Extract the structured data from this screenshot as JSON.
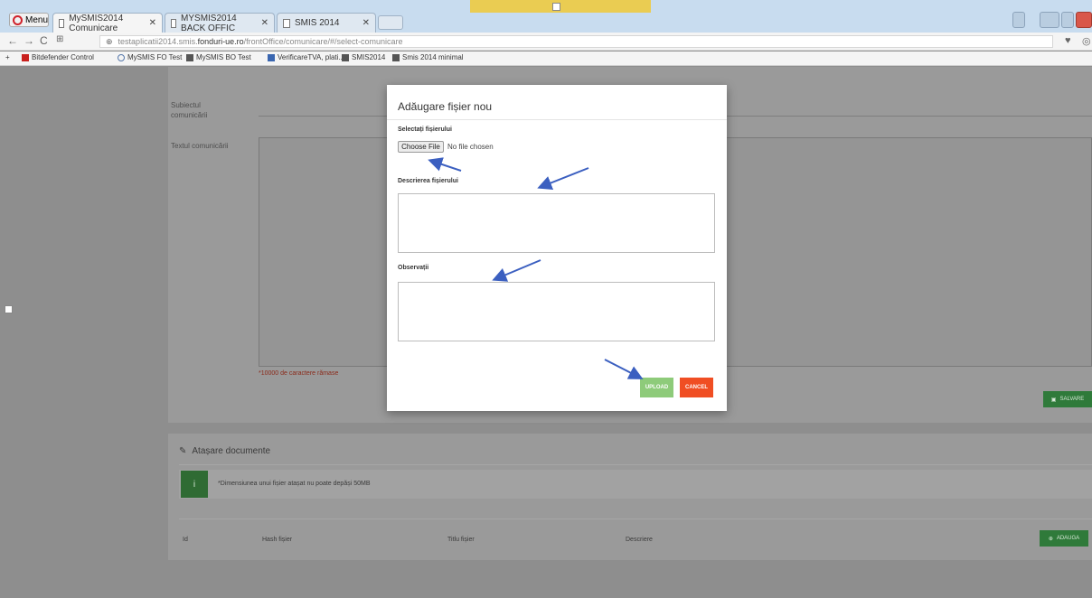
{
  "browser": {
    "opera_menu": "Menu",
    "tabs": [
      {
        "title": "MySMIS2014 Comunicare",
        "active": true
      },
      {
        "title": "MYSMIS2014 BACK OFFIC",
        "active": false
      },
      {
        "title": "SMIS 2014",
        "active": false
      }
    ],
    "url_prefix": "testaplicatii2014.smis.",
    "url_domain": "fonduri-ue.ro",
    "url_path": "/frontOffice/comunicare/#/select-comunicare",
    "bookmarks": [
      {
        "label": "Bitdefender Control"
      },
      {
        "label": "MySMIS FO Test"
      },
      {
        "label": "MySMIS BO Test"
      },
      {
        "label": "VerificareTVA, plati..."
      },
      {
        "label": "SMIS2014"
      },
      {
        "label": "Smis 2014 minimal"
      }
    ]
  },
  "background_page": {
    "subject_label_1": "Subiectul",
    "subject_label_2": "comunicării",
    "text_label": "Textul comunicării",
    "char_note": "*10000 de caractere rămase",
    "save_label": "SALVARE",
    "attachments_title": "Atașare documente",
    "info_text": "*Dimensiunea unui fișier atașat nu poate depăși 50MB",
    "table_headers": [
      "Id",
      "Hash fișier",
      "Titlu fișier",
      "Descriere"
    ],
    "add_label": "ADAUGA"
  },
  "modal": {
    "title": "Adăugare fișier nou",
    "select_label": "Selectați fișierului",
    "choose_file": "Choose File",
    "no_file": "No file chosen",
    "description_label": "Descrierea fișierului",
    "observations_label": "Observații",
    "upload_label": "UPLOAD",
    "cancel_label": "CANCEL"
  },
  "colors": {
    "upload": "#8ecb7a",
    "cancel": "#f04e23",
    "annotation_arrow": "#3b5fc0",
    "tab_bar": "#c8dcef"
  }
}
